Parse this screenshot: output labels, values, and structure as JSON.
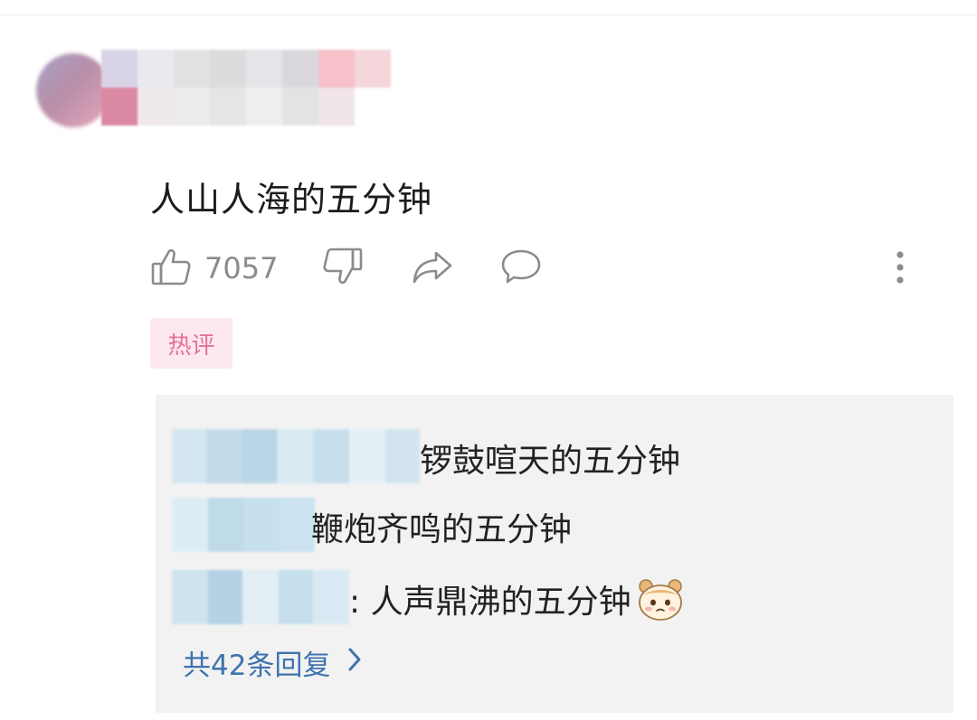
{
  "comment": {
    "text": "人山人海的五分钟",
    "like_count": "7057",
    "badge": "热评"
  },
  "icons": {
    "like": "thumbs-up-icon",
    "dislike": "thumbs-down-icon",
    "share": "share-icon",
    "reply": "comment-bubble-icon",
    "more": "more-vertical-icon"
  },
  "replies": [
    {
      "text": "锣鼓喧天的五分钟"
    },
    {
      "text": "鞭炮齐鸣的五分钟"
    },
    {
      "text": ": 人声鼎沸的五分钟",
      "emoji": "hamster-emoji"
    }
  ],
  "more_replies": {
    "label": "共42条回复",
    "chevron": "chevron-right-icon"
  },
  "colors": {
    "badge_bg": "#fde8ef",
    "badge_text": "#e5709a",
    "link": "#3e73ad",
    "reply_bg": "#f2f2f2",
    "icon_gray": "#8b8b8b"
  }
}
